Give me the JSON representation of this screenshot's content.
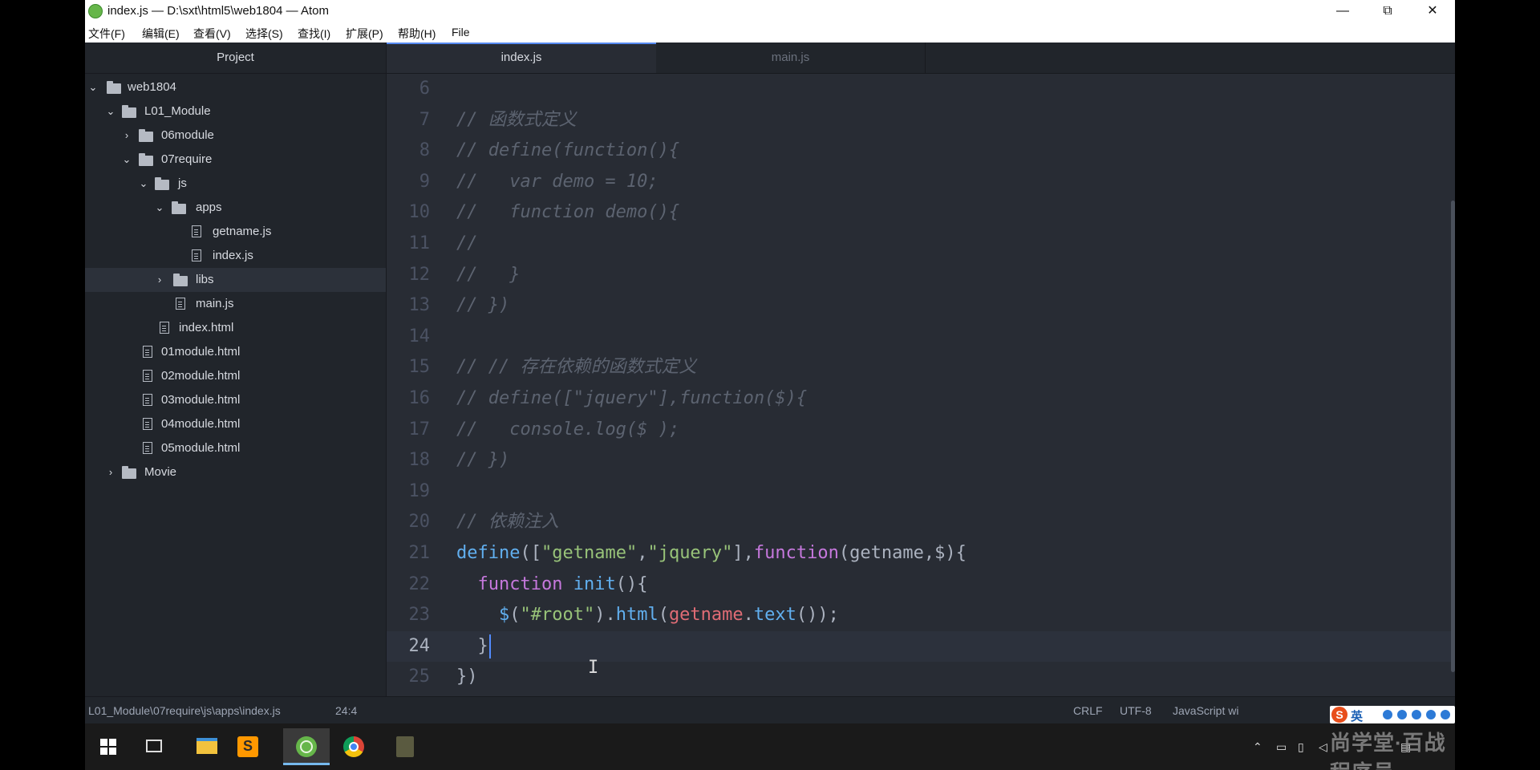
{
  "window": {
    "title": "index.js — D:\\sxt\\html5\\web1804 — Atom",
    "controls": {
      "minimize": "—",
      "restore": "⧉",
      "close": "✕"
    }
  },
  "menu": [
    "文件(F)",
    "编辑(E)",
    "查看(V)",
    "选择(S)",
    "查找(I)",
    "扩展(P)",
    "帮助(H)",
    "File"
  ],
  "tree": {
    "header": "Project",
    "items": [
      {
        "label": "web1804",
        "type": "folder",
        "expanded": true
      },
      {
        "label": "L01_Module",
        "type": "folder",
        "expanded": true
      },
      {
        "label": "06module",
        "type": "folder",
        "expanded": false
      },
      {
        "label": "07require",
        "type": "folder",
        "expanded": true
      },
      {
        "label": "js",
        "type": "folder",
        "expanded": true
      },
      {
        "label": "apps",
        "type": "folder",
        "expanded": true
      },
      {
        "label": "getname.js",
        "type": "file"
      },
      {
        "label": "index.js",
        "type": "file"
      },
      {
        "label": "libs",
        "type": "folder",
        "expanded": false,
        "selected": true
      },
      {
        "label": "main.js",
        "type": "file"
      },
      {
        "label": "index.html",
        "type": "file"
      },
      {
        "label": "01module.html",
        "type": "file"
      },
      {
        "label": "02module.html",
        "type": "file"
      },
      {
        "label": "03module.html",
        "type": "file"
      },
      {
        "label": "04module.html",
        "type": "file"
      },
      {
        "label": "05module.html",
        "type": "file"
      },
      {
        "label": "Movie",
        "type": "folder",
        "expanded": false
      }
    ]
  },
  "tabs": [
    {
      "label": "index.js",
      "active": true
    },
    {
      "label": "main.js",
      "active": false
    }
  ],
  "editor": {
    "lines": [
      {
        "n": "6",
        "segs": []
      },
      {
        "n": "7",
        "segs": [
          {
            "t": "// 函数式定义",
            "c": "comment"
          }
        ]
      },
      {
        "n": "8",
        "segs": [
          {
            "t": "// define(function(){",
            "c": "comment"
          }
        ]
      },
      {
        "n": "9",
        "segs": [
          {
            "t": "//   var demo = 10;",
            "c": "comment"
          }
        ]
      },
      {
        "n": "10",
        "segs": [
          {
            "t": "//   function demo(){",
            "c": "comment"
          }
        ]
      },
      {
        "n": "11",
        "segs": [
          {
            "t": "//",
            "c": "comment"
          }
        ]
      },
      {
        "n": "12",
        "segs": [
          {
            "t": "//   }",
            "c": "comment"
          }
        ]
      },
      {
        "n": "13",
        "segs": [
          {
            "t": "// })",
            "c": "comment"
          }
        ]
      },
      {
        "n": "14",
        "segs": []
      },
      {
        "n": "15",
        "segs": [
          {
            "t": "// // 存在依赖的函数式定义",
            "c": "comment"
          }
        ]
      },
      {
        "n": "16",
        "segs": [
          {
            "t": "// define([\"jquery\"],function($){",
            "c": "comment"
          }
        ]
      },
      {
        "n": "17",
        "segs": [
          {
            "t": "//   console.log($ );",
            "c": "comment"
          }
        ]
      },
      {
        "n": "18",
        "segs": [
          {
            "t": "// })",
            "c": "comment"
          }
        ]
      },
      {
        "n": "19",
        "segs": []
      },
      {
        "n": "20",
        "segs": [
          {
            "t": "// 依赖注入",
            "c": "comment"
          }
        ]
      },
      {
        "n": "21",
        "segs": [
          {
            "t": "define",
            "c": "fn"
          },
          {
            "t": "([",
            "c": "plain"
          },
          {
            "t": "\"getname\"",
            "c": "str"
          },
          {
            "t": ",",
            "c": "plain"
          },
          {
            "t": "\"jquery\"",
            "c": "str"
          },
          {
            "t": "],",
            "c": "plain"
          },
          {
            "t": "function",
            "c": "kw"
          },
          {
            "t": "(getname,$){",
            "c": "plain"
          }
        ]
      },
      {
        "n": "22",
        "segs": [
          {
            "t": "  ",
            "c": "plain"
          },
          {
            "t": "function",
            "c": "kw"
          },
          {
            "t": " ",
            "c": "plain"
          },
          {
            "t": "init",
            "c": "fn"
          },
          {
            "t": "(){",
            "c": "plain"
          }
        ]
      },
      {
        "n": "23",
        "segs": [
          {
            "t": "    ",
            "c": "plain"
          },
          {
            "t": "$",
            "c": "fn"
          },
          {
            "t": "(",
            "c": "plain"
          },
          {
            "t": "\"#root\"",
            "c": "str"
          },
          {
            "t": ").",
            "c": "plain"
          },
          {
            "t": "html",
            "c": "fn"
          },
          {
            "t": "(",
            "c": "plain"
          },
          {
            "t": "getname",
            "c": "var"
          },
          {
            "t": ".",
            "c": "plain"
          },
          {
            "t": "text",
            "c": "fn"
          },
          {
            "t": "());",
            "c": "plain"
          }
        ]
      },
      {
        "n": "24",
        "segs": [
          {
            "t": "  }",
            "c": "plain"
          }
        ],
        "cursor": true
      },
      {
        "n": "25",
        "segs": [
          {
            "t": "})",
            "c": "plain"
          }
        ]
      }
    ]
  },
  "status": {
    "path": "L01_Module\\07require\\js\\apps\\index.js",
    "position": "24:4",
    "line_ending": "CRLF",
    "encoding": "UTF-8",
    "grammar": "JavaScript wi"
  },
  "ime": {
    "logo": "S",
    "mode": "英"
  },
  "taskbar": {
    "tray_clock": "",
    "watermark": "尚学堂·百战程序员"
  },
  "colors": {
    "accent": "#568af2",
    "comment": "#5c6370",
    "keyword": "#c678dd",
    "string": "#98c379",
    "function": "#61afef"
  }
}
